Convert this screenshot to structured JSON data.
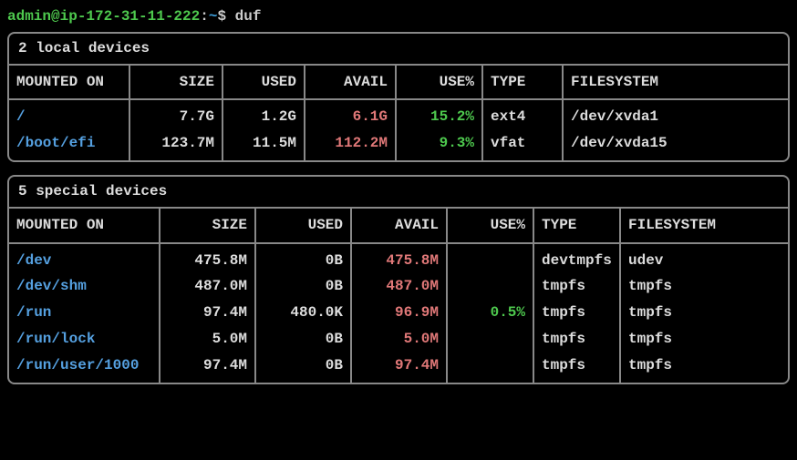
{
  "prompt": {
    "user_host": "admin@ip-172-31-11-222",
    "colon": ":",
    "path": "~",
    "dollar": "$",
    "cmd": "duf"
  },
  "panels": [
    {
      "title": "2 local devices",
      "headers": [
        "MOUNTED ON",
        "SIZE",
        "USED",
        "AVAIL",
        "USE%",
        "TYPE",
        "FILESYSTEM"
      ],
      "rows": [
        {
          "mount": "/",
          "size": "7.7G",
          "used": "1.2G",
          "avail": "6.1G",
          "use": "15.2%",
          "type": "ext4",
          "fs": "/dev/xvda1"
        },
        {
          "mount": "/boot/efi",
          "size": "123.7M",
          "used": "11.5M",
          "avail": "112.2M",
          "use": "9.3%",
          "type": "vfat",
          "fs": "/dev/xvda15"
        }
      ]
    },
    {
      "title": "5 special devices",
      "headers": [
        "MOUNTED ON",
        "SIZE",
        "USED",
        "AVAIL",
        "USE%",
        "TYPE",
        "FILESYSTEM"
      ],
      "rows": [
        {
          "mount": "/dev",
          "size": "475.8M",
          "used": "0B",
          "avail": "475.8M",
          "use": "",
          "type": "devtmpfs",
          "fs": "udev"
        },
        {
          "mount": "/dev/shm",
          "size": "487.0M",
          "used": "0B",
          "avail": "487.0M",
          "use": "",
          "type": "tmpfs",
          "fs": "tmpfs"
        },
        {
          "mount": "/run",
          "size": "97.4M",
          "used": "480.0K",
          "avail": "96.9M",
          "use": "0.5%",
          "type": "tmpfs",
          "fs": "tmpfs"
        },
        {
          "mount": "/run/lock",
          "size": "5.0M",
          "used": "0B",
          "avail": "5.0M",
          "use": "",
          "type": "tmpfs",
          "fs": "tmpfs"
        },
        {
          "mount": "/run/user/1000",
          "size": "97.4M",
          "used": "0B",
          "avail": "97.4M",
          "use": "",
          "type": "tmpfs",
          "fs": "tmpfs"
        }
      ]
    }
  ]
}
